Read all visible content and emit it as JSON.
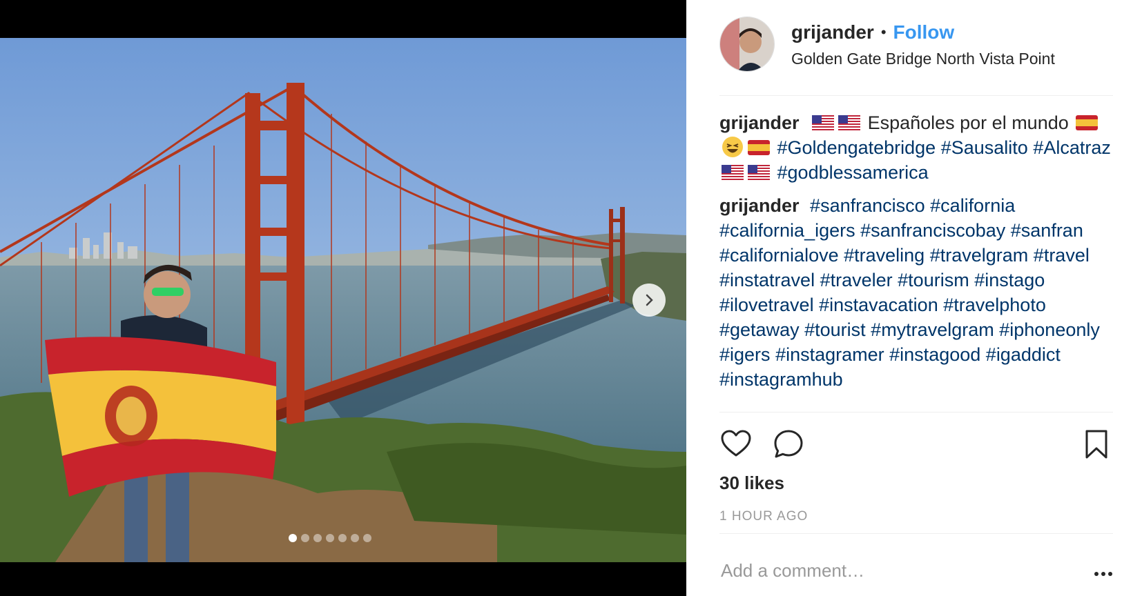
{
  "post": {
    "username": "grijander",
    "separator": "•",
    "follow_label": "Follow",
    "location": "Golden Gate Bridge North Vista Point",
    "carousel": {
      "slide_count": 7,
      "active_index": 0
    },
    "caption": {
      "user": "grijander",
      "line1_text": "Españoles por el mundo",
      "tags1": [
        "#Goldengatebridge",
        "#Sausalito",
        "#Alcatraz",
        "#godblessamerica"
      ]
    },
    "second_comment": {
      "user": "grijander",
      "tags": [
        "#sanfrancisco",
        "#california",
        "#california_igers",
        "#sanfranciscobay",
        "#sanfran",
        "#californialove",
        "#traveling",
        "#travelgram",
        "#travel",
        "#instatravel",
        "#traveler",
        "#tourism",
        "#instago",
        "#ilovetravel",
        "#instavacation",
        "#travelphoto",
        "#getaway",
        "#tourist",
        "#mytravelgram",
        "#iphoneonly",
        "#igers",
        "#instagramer",
        "#instagood",
        "#igaddict",
        "#instagramhub"
      ]
    },
    "likes": "30 likes",
    "timestamp": "1 HOUR AGO",
    "comment_placeholder": "Add a comment…",
    "icons": {
      "like": "heart-icon",
      "comment": "comment-bubble-icon",
      "save": "bookmark-icon",
      "options": "more-options-icon",
      "next": "chevron-right-icon"
    },
    "colors": {
      "link_blue": "#3897f0",
      "hashtag": "#003569",
      "muted": "#999999"
    }
  }
}
